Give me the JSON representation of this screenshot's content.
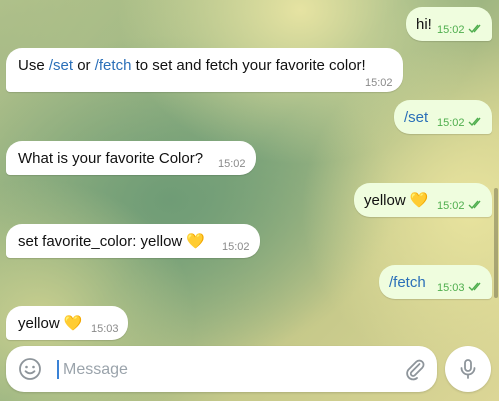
{
  "messages": [
    {
      "dir": "out",
      "parts": [
        {
          "t": "hi!",
          "cmd": false
        }
      ],
      "time": "15:02",
      "status": "read"
    },
    {
      "dir": "in",
      "parts": [
        {
          "t": "Use ",
          "cmd": false
        },
        {
          "t": "/set",
          "cmd": true
        },
        {
          "t": " or ",
          "cmd": false
        },
        {
          "t": "/fetch",
          "cmd": true
        },
        {
          "t": " to set and fetch your favorite color!",
          "cmd": false
        }
      ],
      "time": "15:02"
    },
    {
      "dir": "out",
      "parts": [
        {
          "t": "/set",
          "cmd": true
        }
      ],
      "time": "15:02",
      "status": "read"
    },
    {
      "dir": "in",
      "parts": [
        {
          "t": "What is your favorite Color?",
          "cmd": false
        }
      ],
      "time": "15:02"
    },
    {
      "dir": "out",
      "parts": [
        {
          "t": "yellow 💛",
          "cmd": false
        }
      ],
      "time": "15:02",
      "status": "read"
    },
    {
      "dir": "in",
      "parts": [
        {
          "t": "set favorite_color: yellow 💛",
          "cmd": false
        }
      ],
      "time": "15:02"
    },
    {
      "dir": "out",
      "parts": [
        {
          "t": "/fetch",
          "cmd": true
        }
      ],
      "time": "15:03",
      "status": "read"
    },
    {
      "dir": "in",
      "parts": [
        {
          "t": "yellow 💛",
          "cmd": false
        }
      ],
      "time": "15:03"
    }
  ],
  "composer": {
    "placeholder": "Message",
    "value": "",
    "emoji_icon": "emoji-icon",
    "attach_icon": "paperclip-icon",
    "send_icon": "microphone-icon"
  },
  "colors": {
    "incoming_bg": "#ffffff",
    "outgoing_bg": "#effdde",
    "command_link": "#2a6fb8",
    "outgoing_time": "#4fae4e",
    "incoming_time": "#8a8a8a",
    "caret": "#3a82d6"
  }
}
